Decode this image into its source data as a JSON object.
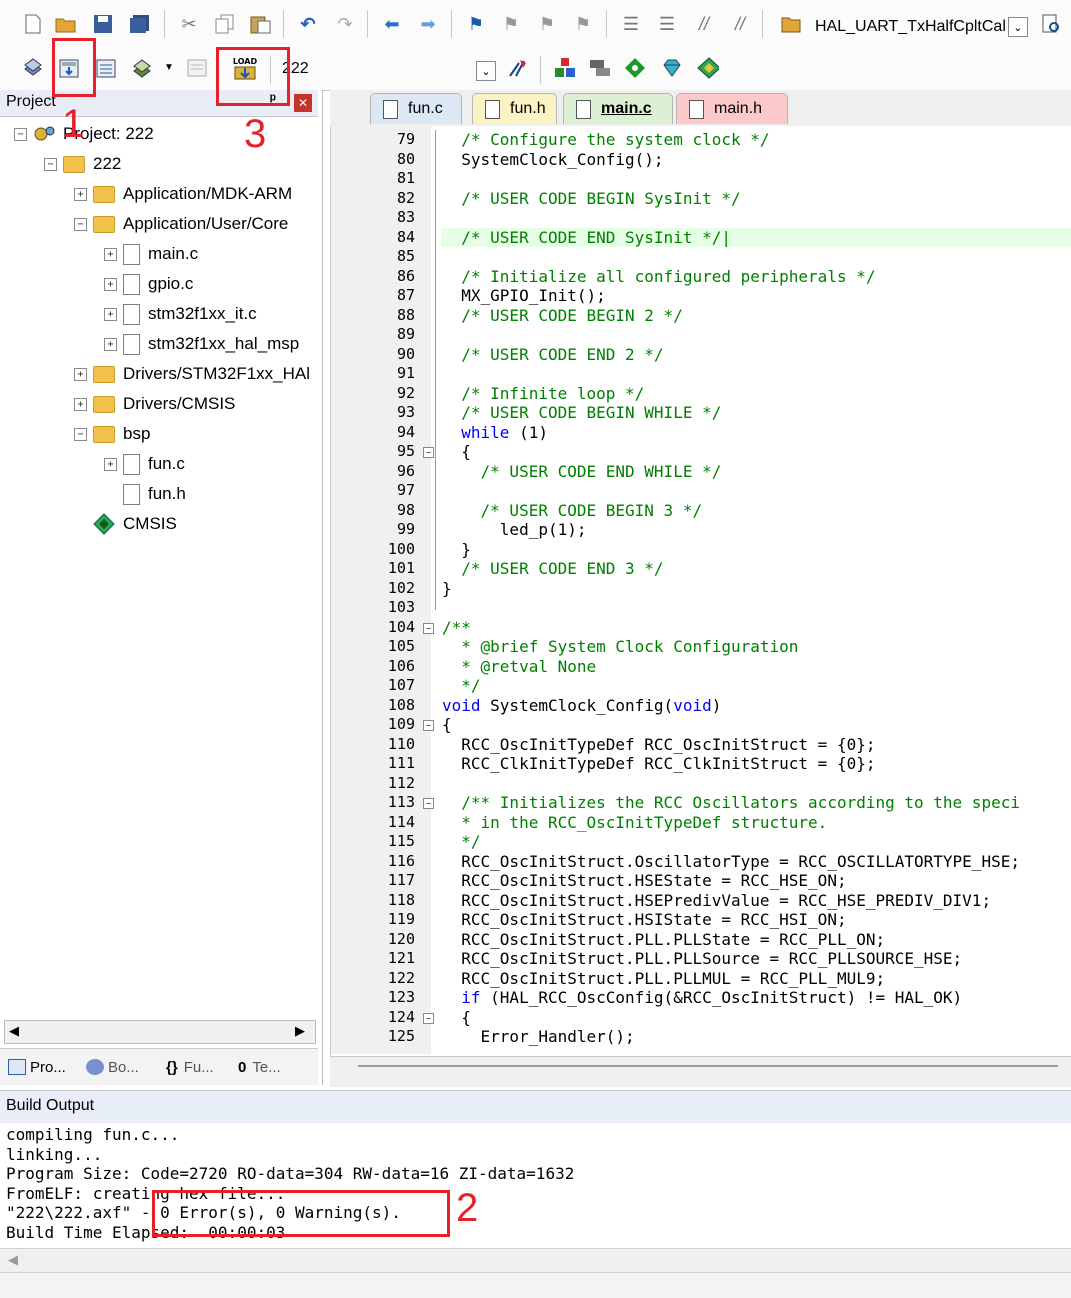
{
  "toolbar1": {
    "icons": [
      "new-file-icon",
      "open-folder-icon",
      "save-icon",
      "save-all-icon",
      "cut-icon",
      "copy-icon",
      "paste-icon",
      "undo-icon",
      "redo-icon",
      "navigate-back-icon",
      "navigate-forward-icon",
      "bookmark-icon",
      "bookmark-prev-icon",
      "bookmark-next-icon",
      "bookmark-clear-icon",
      "indent-icon",
      "unindent-icon",
      "comment-icon",
      "uncomment-icon",
      "find-in-files-icon"
    ],
    "combo_value": "HAL_UART_TxHalfCpltCal",
    "combo_arrow": "⌄"
  },
  "toolbar2": {
    "icons": [
      "translate-icon",
      "build-icon",
      "rebuild-icon",
      "batch-build-icon",
      "dropdown-arrow-icon",
      "stop-build-icon",
      "load-download-icon",
      "options-icon",
      "manage-components-icon",
      "pack-installer-icon",
      "select-packs-icon",
      "green-diamond-icon",
      "gem-icon"
    ],
    "target_name": "222",
    "load_icon_text": "LOAD"
  },
  "project_panel": {
    "title": "Project",
    "pin": "ᵖ",
    "close": "✕",
    "tree": [
      {
        "label": "Project: 222",
        "level": 0,
        "expander": "−",
        "icon": "project-icon"
      },
      {
        "label": "222",
        "level": 1,
        "expander": "−",
        "icon": "target-folder-icon"
      },
      {
        "label": "Application/MDK-ARM",
        "level": 2,
        "expander": "+",
        "icon": "folder-icon"
      },
      {
        "label": "Application/User/Core",
        "level": 2,
        "expander": "−",
        "icon": "folder-open-icon"
      },
      {
        "label": "main.c",
        "level": 3,
        "expander": "+",
        "icon": "file-icon"
      },
      {
        "label": "gpio.c",
        "level": 3,
        "expander": "+",
        "icon": "file-icon"
      },
      {
        "label": "stm32f1xx_it.c",
        "level": 3,
        "expander": "+",
        "icon": "file-icon"
      },
      {
        "label": "stm32f1xx_hal_msp",
        "level": 3,
        "expander": "+",
        "icon": "file-icon"
      },
      {
        "label": "Drivers/STM32F1xx_HAl",
        "level": 2,
        "expander": "+",
        "icon": "folder-icon"
      },
      {
        "label": "Drivers/CMSIS",
        "level": 2,
        "expander": "+",
        "icon": "folder-icon"
      },
      {
        "label": "bsp",
        "level": 2,
        "expander": "−",
        "icon": "folder-open-icon"
      },
      {
        "label": "fun.c",
        "level": 3,
        "expander": "+",
        "icon": "file-icon"
      },
      {
        "label": "fun.h",
        "level": 3,
        "expander": "",
        "icon": "file-icon"
      },
      {
        "label": "CMSIS",
        "level": 2,
        "expander": "",
        "icon": "green-diamond-icon"
      }
    ],
    "tabs": [
      {
        "label": "Pro...",
        "icon": "project-tab-icon"
      },
      {
        "label": "Bo...",
        "icon": "books-tab-icon"
      },
      {
        "label": "Fu...",
        "icon": "functions-tab-icon",
        "glyph": "{}"
      },
      {
        "label": "Te...",
        "icon": "templates-tab-icon",
        "glyph": "0"
      }
    ],
    "scroll_left": "◀",
    "scroll_right": "▶"
  },
  "editor": {
    "tabs": [
      {
        "label": "fun.c",
        "bg": "#dde8f5",
        "active": false
      },
      {
        "label": "fun.h",
        "bg": "#fbf3c4",
        "active": false
      },
      {
        "label": "main.c",
        "bg": "#ddf0d4",
        "active": true
      },
      {
        "label": "main.h",
        "bg": "#fbc9c9",
        "active": false
      }
    ],
    "lines": [
      {
        "n": "79",
        "t": "  /* Configure the system clock */",
        "c": "cm"
      },
      {
        "n": "80",
        "t": "  SystemClock_Config();",
        "c": ""
      },
      {
        "n": "81",
        "t": "",
        "c": ""
      },
      {
        "n": "82",
        "t": "  /* USER CODE BEGIN SysInit */",
        "c": "cm"
      },
      {
        "n": "83",
        "t": "",
        "c": ""
      },
      {
        "n": "84",
        "t": "  /* USER CODE END SysInit */|",
        "c": "cm"
      },
      {
        "n": "85",
        "t": "",
        "c": ""
      },
      {
        "n": "86",
        "t": "  /* Initialize all configured peripherals */",
        "c": "cm"
      },
      {
        "n": "87",
        "t": "  MX_GPIO_Init();",
        "c": ""
      },
      {
        "n": "88",
        "t": "  /* USER CODE BEGIN 2 */",
        "c": "cm"
      },
      {
        "n": "89",
        "t": "",
        "c": ""
      },
      {
        "n": "90",
        "t": "  /* USER CODE END 2 */",
        "c": "cm"
      },
      {
        "n": "91",
        "t": "",
        "c": ""
      },
      {
        "n": "92",
        "t": "  /* Infinite loop */",
        "c": "cm"
      },
      {
        "n": "93",
        "t": "  /* USER CODE BEGIN WHILE */",
        "c": "cm"
      },
      {
        "n": "94",
        "t": "  while (1)",
        "c": "kw-while"
      },
      {
        "n": "95",
        "t": "  {",
        "c": "",
        "fold": "−"
      },
      {
        "n": "96",
        "t": "    /* USER CODE END WHILE */",
        "c": "cm"
      },
      {
        "n": "97",
        "t": "",
        "c": ""
      },
      {
        "n": "98",
        "t": "    /* USER CODE BEGIN 3 */",
        "c": "cm"
      },
      {
        "n": "99",
        "t": "      led_p(1);",
        "c": ""
      },
      {
        "n": "100",
        "t": "  }",
        "c": ""
      },
      {
        "n": "101",
        "t": "  /* USER CODE END 3 */",
        "c": "cm"
      },
      {
        "n": "102",
        "t": "}",
        "c": ""
      },
      {
        "n": "103",
        "t": "",
        "c": ""
      },
      {
        "n": "104",
        "t": "/**",
        "c": "cm",
        "fold": "−"
      },
      {
        "n": "105",
        "t": "  * @brief System Clock Configuration",
        "c": "cm"
      },
      {
        "n": "106",
        "t": "  * @retval None",
        "c": "cm"
      },
      {
        "n": "107",
        "t": "  */",
        "c": "cm"
      },
      {
        "n": "108",
        "t": "void SystemClock_Config(void)",
        "c": "kw-void"
      },
      {
        "n": "109",
        "t": "{",
        "c": "",
        "fold": "−"
      },
      {
        "n": "110",
        "t": "  RCC_OscInitTypeDef RCC_OscInitStruct = {0};",
        "c": ""
      },
      {
        "n": "111",
        "t": "  RCC_ClkInitTypeDef RCC_ClkInitStruct = {0};",
        "c": ""
      },
      {
        "n": "112",
        "t": "",
        "c": ""
      },
      {
        "n": "113",
        "t": "  /** Initializes the RCC Oscillators according to the speci",
        "c": "cm",
        "fold": "−"
      },
      {
        "n": "114",
        "t": "  * in the RCC_OscInitTypeDef structure.",
        "c": "cm"
      },
      {
        "n": "115",
        "t": "  */",
        "c": "cm"
      },
      {
        "n": "116",
        "t": "  RCC_OscInitStruct.OscillatorType = RCC_OSCILLATORTYPE_HSE;",
        "c": ""
      },
      {
        "n": "117",
        "t": "  RCC_OscInitStruct.HSEState = RCC_HSE_ON;",
        "c": ""
      },
      {
        "n": "118",
        "t": "  RCC_OscInitStruct.HSEPredivValue = RCC_HSE_PREDIV_DIV1;",
        "c": ""
      },
      {
        "n": "119",
        "t": "  RCC_OscInitStruct.HSIState = RCC_HSI_ON;",
        "c": ""
      },
      {
        "n": "120",
        "t": "  RCC_OscInitStruct.PLL.PLLState = RCC_PLL_ON;",
        "c": ""
      },
      {
        "n": "121",
        "t": "  RCC_OscInitStruct.PLL.PLLSource = RCC_PLLSOURCE_HSE;",
        "c": ""
      },
      {
        "n": "122",
        "t": "  RCC_OscInitStruct.PLL.PLLMUL = RCC_PLL_MUL9;",
        "c": ""
      },
      {
        "n": "123",
        "t": "  if (HAL_RCC_OscConfig(&RCC_OscInitStruct) != HAL_OK)",
        "c": "kw-if"
      },
      {
        "n": "124",
        "t": "  {",
        "c": "",
        "fold": "−"
      },
      {
        "n": "125",
        "t": "    Error_Handler();",
        "c": ""
      }
    ],
    "highlight_line": "84"
  },
  "build_output": {
    "title": "Build Output",
    "lines": [
      "compiling fun.c...",
      "linking...",
      "Program Size: Code=2720 RO-data=304 RW-data=16 ZI-data=1632",
      "FromELF: creating hex file...",
      "\"222\\222.axf\" - 0 Error(s), 0 Warning(s).",
      "Build Time Elapsed:  00:00:03"
    ],
    "scroll_left": "◀"
  },
  "annotations": {
    "color": "#e8202c",
    "labels": [
      "1",
      "2",
      "3"
    ]
  }
}
